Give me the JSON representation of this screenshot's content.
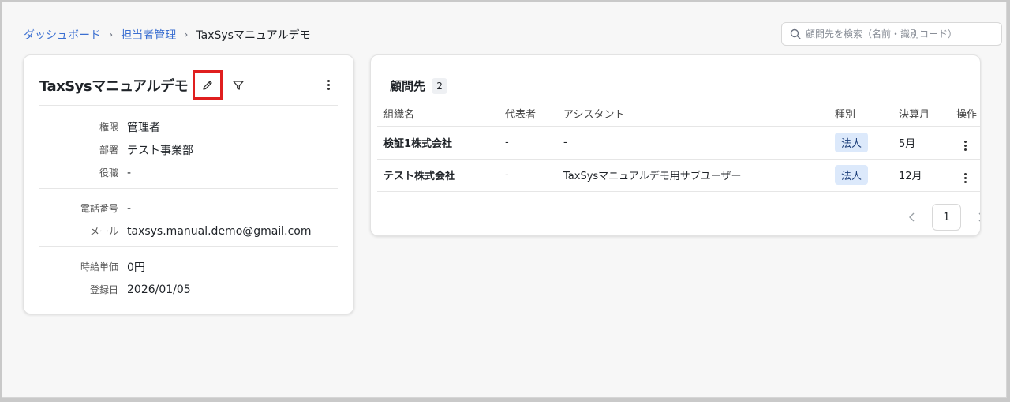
{
  "breadcrumb": {
    "items": [
      "ダッシュボード",
      "担当者管理"
    ],
    "current": "TaxSysマニュアルデモ",
    "separator": "›"
  },
  "search": {
    "placeholder": "顧問先を検索（名前・識別コード）",
    "value": "",
    "icon": "search-icon"
  },
  "profile": {
    "name": "TaxSysマニュアルデモ",
    "icons": [
      "pencil-icon",
      "filter-icon",
      "more-vertical-icon"
    ],
    "highlight_color": "#e01f1f",
    "sections": [
      [
        {
          "label": "権限",
          "value": "管理者"
        },
        {
          "label": "部署",
          "value": "テスト事業部"
        },
        {
          "label": "役職",
          "value": "-"
        }
      ],
      [
        {
          "label": "電話番号",
          "value": "-"
        },
        {
          "label": "メール",
          "value": "taxsys.manual.demo@gmail.com"
        }
      ],
      [
        {
          "label": "時給単価",
          "value": "0円"
        },
        {
          "label": "登録日",
          "value": "2026/01/05"
        }
      ]
    ]
  },
  "clients": {
    "title": "顧問先",
    "count": "2",
    "columns": [
      "組織名",
      "代表者",
      "アシスタント",
      "種別",
      "決算月",
      "操作"
    ],
    "rows": [
      {
        "org": "検証1株式会社",
        "rep": "-",
        "assistant": "-",
        "type": "法人",
        "month": "5月"
      },
      {
        "org": "テスト株式会社",
        "rep": "-",
        "assistant": "TaxSysマニュアルデモ用サブユーザー",
        "type": "法人",
        "month": "12月"
      }
    ],
    "pagination": {
      "current_page": "1"
    }
  },
  "colors": {
    "link": "#3b6fd1",
    "badge_bg": "#dce9fb"
  }
}
